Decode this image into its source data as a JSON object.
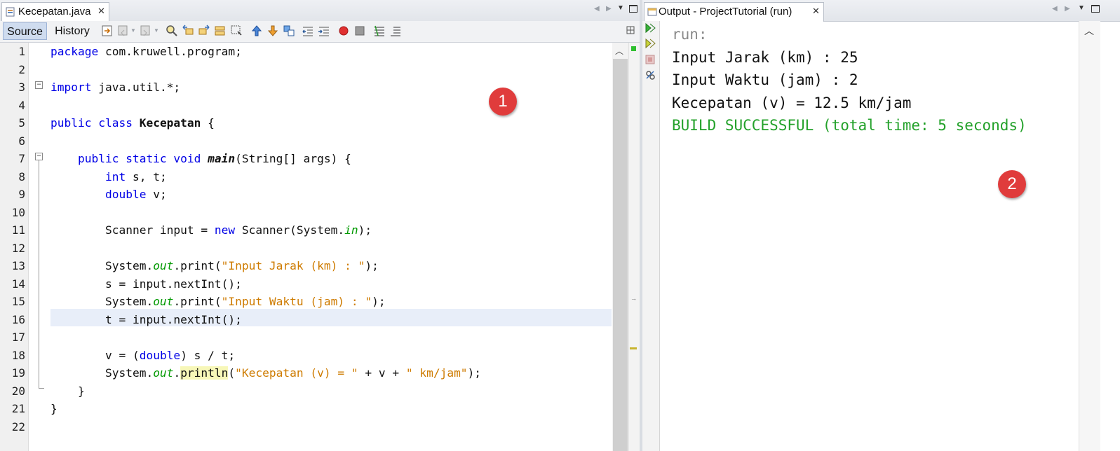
{
  "editor": {
    "tab_title": "Kecepatan.java",
    "source_label": "Source",
    "history_label": "History",
    "line_numbers": [
      "1",
      "2",
      "3",
      "4",
      "5",
      "6",
      "7",
      "8",
      "9",
      "10",
      "11",
      "12",
      "13",
      "14",
      "15",
      "16",
      "17",
      "18",
      "19",
      "20",
      "21",
      "22"
    ],
    "code": {
      "l1_kw": "package",
      "l1_rest": " com.kruwell.program;",
      "l3_kw": "import",
      "l3_rest": " java.util.*;",
      "l5_kw": "public class",
      "l5_sp": " ",
      "l5_name": "Kecepatan",
      "l5_rest": " {",
      "l7_indent": "    ",
      "l7_kw": "public static void",
      "l7_sp": " ",
      "l7_name": "main",
      "l7_rest": "(String[] args) {",
      "l8_indent": "        ",
      "l8_kw": "int",
      "l8_rest": " s, t;",
      "l9_indent": "        ",
      "l9_kw": "double",
      "l9_rest": " v;",
      "l11_a": "        Scanner input = ",
      "l11_kw": "new",
      "l11_b": " Scanner(System.",
      "l11_fld": "in",
      "l11_c": ");",
      "l13_a": "        System.",
      "l13_fld": "out",
      "l13_b": ".print(",
      "l13_str": "\"Input Jarak (km) : \"",
      "l13_c": ");",
      "l14": "        s = input.nextInt();",
      "l15_a": "        System.",
      "l15_fld": "out",
      "l15_b": ".print(",
      "l15_str": "\"Input Waktu (jam) : \"",
      "l15_c": ");",
      "l16": "        t = input.nextInt();",
      "l18_a": "        v = (",
      "l18_kw": "double",
      "l18_b": ") s / t;",
      "l19_a": "        System.",
      "l19_fld": "out",
      "l19_dot": ".",
      "l19_hl": "println",
      "l19_b": "(",
      "l19_str1": "\"Kecepatan (v) = \"",
      "l19_c": " + v + ",
      "l19_str2": "\" km/jam\"",
      "l19_d": ");",
      "l20": "    }",
      "l21": "}"
    },
    "badge": "1"
  },
  "output": {
    "tab_title": "Output - ProjectTutorial (run)",
    "lines": {
      "run": "run:",
      "jarak": "Input Jarak (km) : 25",
      "waktu": "Input Waktu (jam) : 2",
      "hasil": "Kecepatan (v) = 12.5 km/jam",
      "build": "BUILD SUCCESSFUL (total time: 5 seconds)"
    },
    "badge": "2"
  },
  "icons": {
    "close": "close-icon",
    "rerun": "rerun-icon",
    "stop": "stop-icon",
    "settings": "settings-icon"
  },
  "colors": {
    "keyword": "#0000e6",
    "string": "#ce7b00",
    "field": "#009900",
    "build_success": "#23a12a",
    "badge": "#e03c3c",
    "current_line": "#e8eef9"
  }
}
